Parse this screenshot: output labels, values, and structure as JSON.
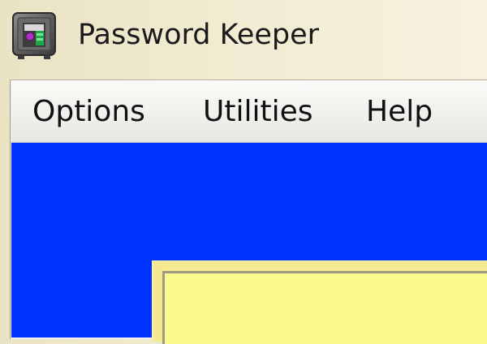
{
  "window": {
    "title": "Password Keeper",
    "icon": "safe-icon"
  },
  "menubar": {
    "items": [
      {
        "label": "Options"
      },
      {
        "label": "Utilities"
      },
      {
        "label": "Help"
      }
    ]
  },
  "colors": {
    "client_background": "#0033ff",
    "panel_background": "#fbfa8e",
    "titlebar_background": "#f1ebd2"
  }
}
